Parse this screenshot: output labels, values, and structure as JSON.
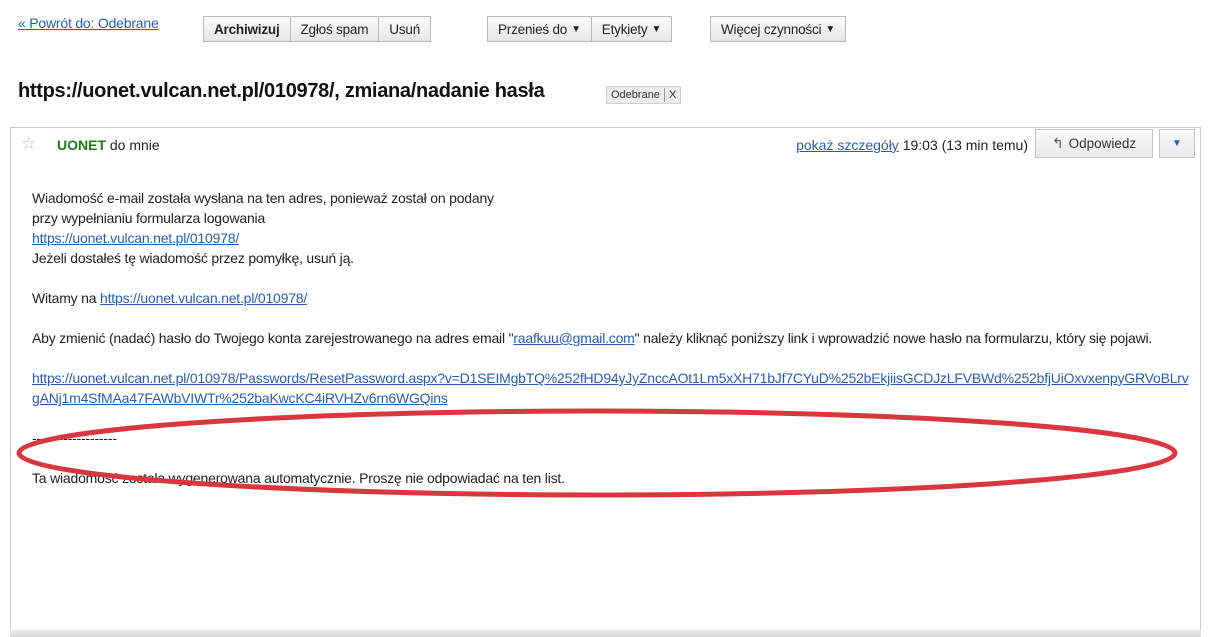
{
  "toolbar": {
    "back_label": "« Powrót do: Odebrane",
    "archive_label": "Archiwizuj",
    "spam_label": "Zgłoś spam",
    "delete_label": "Usuń",
    "move_label": "Przenieś do",
    "labels_label": "Etykiety",
    "more_label": "Więcej czynności"
  },
  "subject": {
    "title": "https://uonet.vulcan.net.pl/010978/, zmiana/nadanie hasła",
    "label": "Odebrane",
    "label_remove": "X"
  },
  "message": {
    "sender_name": "UONET",
    "sender_suffix": "do mnie",
    "details_link": "pokaż szczegóły",
    "time": "19:03 (13 min temu)",
    "reply_label": "Odpowiedz",
    "body": {
      "line1": "Wiadomość e-mail została wysłana na ten adres, ponieważ został on podany",
      "line2": "przy wypełnianiu formularza logowania",
      "link1": "https://uonet.vulcan.net.pl/010978/",
      "line3": "Jeżeli dostałeś tę wiadomość przez pomyłkę, usuń ją.",
      "welcome_prefix": "Witamy na ",
      "welcome_link": "https://uonet.vulcan.net.pl/010978/",
      "change_prefix": "Aby zmienić (nadać) hasło do Twojego konta zarejestrowanego na adres email \"",
      "change_email": "raafkuu@gmail.com",
      "change_suffix": "\" należy kliknąć poniższy link i wprowadzić nowe hasło na formularzu, który się pojawi.",
      "reset_link": "https://uonet.vulcan.net.pl/010978/Passwords/ResetPassword.aspx?v=D1SEIMgbTQ%252fHD94yJyZnccAOt1Lm5xXH71bJf7CYuD%252bEkjiisGCDJzLFVBWd%252bfjUiOxvxenpyGRVoBLrvgANj1m4SfMAa47FAWbVIWTr%252baKwcKC4iRVHZv6rn6WGQins",
      "separator": "-------------------",
      "footer": "Ta wiadomość została wygenerowana automatycznie. Proszę nie odpowiadać na ten list."
    }
  },
  "colors": {
    "link": "#2a5db0",
    "sender": "#1a7d1a",
    "annotation_oval": "#d9363e"
  }
}
